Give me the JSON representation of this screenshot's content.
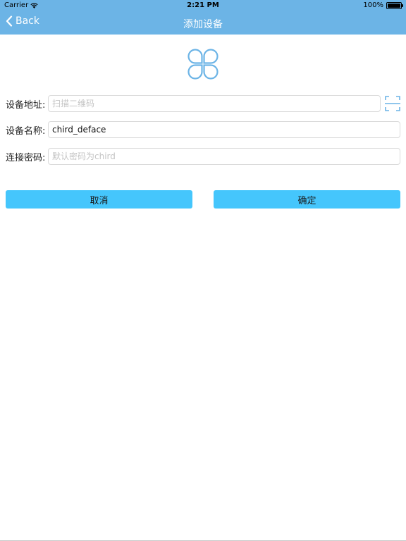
{
  "status_bar": {
    "carrier": "Carrier",
    "time": "2:21 PM",
    "battery": "100%",
    "battery_level": 1.0,
    "wifi_icon": "wifi-icon"
  },
  "nav": {
    "back_label": "Back",
    "title": "添加设备"
  },
  "logo": {
    "icon": "clover-logo-icon",
    "color": "#6cb4e6"
  },
  "form": {
    "address": {
      "label": "设备地址:",
      "value": "",
      "placeholder": "扫描二维码",
      "scan_icon": "qr-scan-icon"
    },
    "name": {
      "label": "设备名称:",
      "value": "chird_deface",
      "placeholder": ""
    },
    "password": {
      "label": "连接密码:",
      "value": "",
      "placeholder": "默认密码为chird"
    }
  },
  "buttons": {
    "cancel": "取消",
    "confirm": "确定"
  },
  "colors": {
    "header": "#6cb4e6",
    "button": "#45c6fc"
  }
}
